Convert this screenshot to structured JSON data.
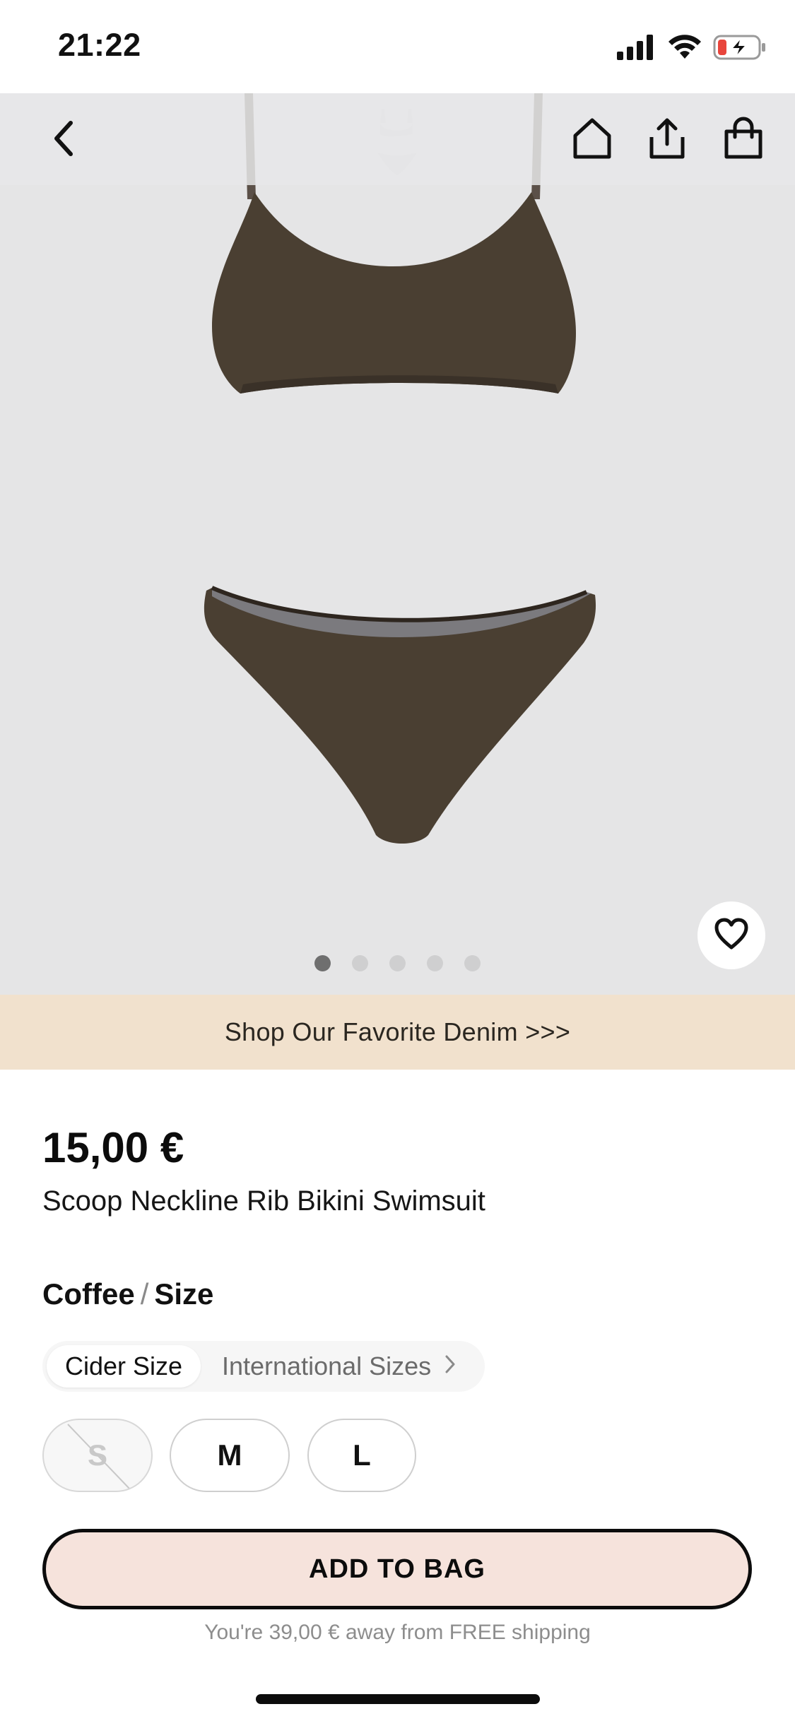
{
  "status_bar": {
    "time": "21:22"
  },
  "icons": {
    "back": "chevron-left-icon",
    "home": "home-icon",
    "share": "share-icon",
    "bag": "shopping-bag-icon",
    "wishlist": "heart-icon",
    "tab_arrow": "chevron-right-icon"
  },
  "gallery": {
    "image_count": 5,
    "active_index": 0
  },
  "promo": {
    "text": "Shop Our Favorite Denim >>>"
  },
  "product": {
    "price": "15,00 €",
    "title": "Scoop Neckline Rib Bikini Swimsuit",
    "color": "Coffee",
    "separator": "/",
    "size_label": "Size"
  },
  "size_tabs": {
    "active": "Cider Size",
    "other": "International Sizes"
  },
  "sizes": [
    {
      "label": "S",
      "available": false
    },
    {
      "label": "M",
      "available": true
    },
    {
      "label": "L",
      "available": true
    }
  ],
  "cta": {
    "add_to_bag": "ADD TO BAG",
    "shipping_note": "You're 39,00 € away from FREE shipping"
  },
  "colors": {
    "banner": "#f1e1cd",
    "cta_fill": "#f6e3dc",
    "product": "#4a3f32"
  }
}
